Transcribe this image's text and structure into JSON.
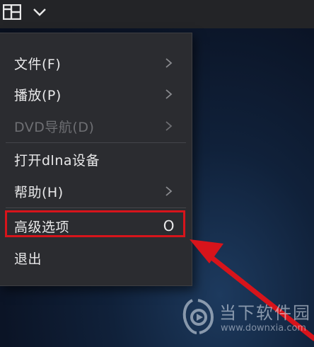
{
  "topbar": {
    "grid_icon": "grid-icon",
    "chevron_icon": "chevron-down-icon"
  },
  "menu": {
    "items": [
      {
        "label": "文件(F)",
        "submenu": true,
        "disabled": false
      },
      {
        "label": "播放(P)",
        "submenu": true,
        "disabled": false
      },
      {
        "label": "DVD导航(D)",
        "submenu": true,
        "disabled": true
      },
      {
        "label": "打开dlna设备",
        "submenu": false,
        "disabled": false
      },
      {
        "label": "帮助(H)",
        "submenu": true,
        "disabled": false
      },
      {
        "label": "高级选项",
        "shortcut": "O",
        "submenu": false,
        "disabled": false,
        "highlighted": true
      },
      {
        "label": "退出",
        "submenu": false,
        "disabled": false
      }
    ]
  },
  "annotation": {
    "highlight_color": "#d7141b",
    "arrow_color": "#d7141b"
  },
  "watermark": {
    "title": "当下软件园",
    "url": "www.downxia.com"
  }
}
